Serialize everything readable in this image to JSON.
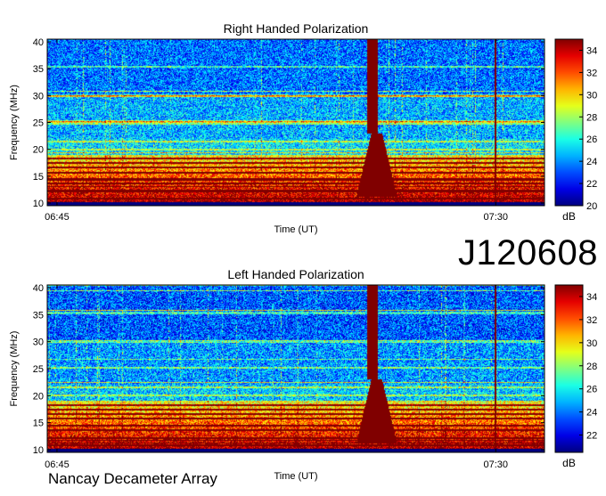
{
  "observation_id": "J120608",
  "footer_label": "Nancay Decameter Array",
  "chart_data": [
    {
      "type": "heatmap",
      "title": "Right Handed Polarization",
      "xlabel": "Time (UT)",
      "ylabel": "Frequency (MHz)",
      "x_ticks": [
        "06:45",
        "07:30"
      ],
      "x_tick_values_min_utc": [
        405,
        450
      ],
      "xlim_min_utc": [
        404,
        455
      ],
      "ylim": [
        9.5,
        40.5
      ],
      "y_ticks": [
        10,
        15,
        20,
        25,
        30,
        35,
        40
      ],
      "colorbar": {
        "label": "dB",
        "range": [
          20,
          35
        ],
        "ticks": [
          20,
          22,
          24,
          26,
          28,
          30,
          32,
          34
        ],
        "colormap": "jet"
      },
      "features": {
        "burst_time_min": 437.8,
        "burst_upper_time_min": 437.4,
        "burst_freq_range": [
          11.5,
          40
        ],
        "narrow_line_time_min": 450.0,
        "band_freq_range": [
          10,
          19
        ]
      }
    },
    {
      "type": "heatmap",
      "title": "Left Handed Polarization",
      "xlabel": "Time (UT)",
      "ylabel": "Frequency (MHz)",
      "x_ticks": [
        "06:45",
        "07:30"
      ],
      "x_tick_values_min_utc": [
        405,
        450
      ],
      "xlim_min_utc": [
        404,
        455
      ],
      "ylim": [
        9.5,
        40.5
      ],
      "y_ticks": [
        10,
        15,
        20,
        25,
        30,
        35,
        40
      ],
      "colorbar": {
        "label": "dB",
        "range": [
          20.5,
          35
        ],
        "ticks": [
          22,
          24,
          26,
          28,
          30,
          32,
          34
        ],
        "colormap": "jet"
      },
      "features": {
        "burst_time_min": 437.8,
        "burst_upper_time_min": 437.4,
        "burst_freq_range": [
          11.5,
          40
        ],
        "narrow_line_time_min": 450.0,
        "band_freq_range": [
          10,
          19
        ]
      }
    }
  ]
}
